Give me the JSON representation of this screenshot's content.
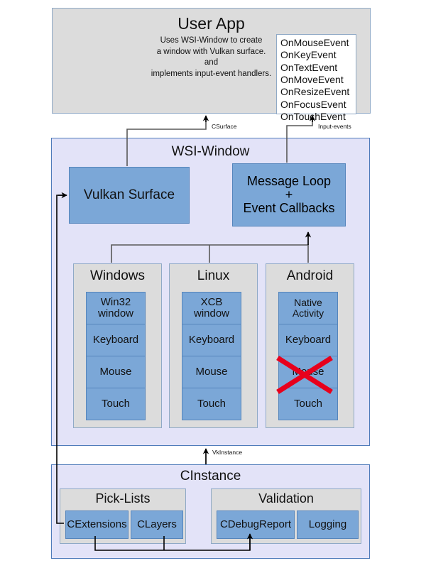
{
  "diagram": {
    "user_app": {
      "title": "User App",
      "description_lines": [
        "Uses WSI-Window to create",
        "a window with Vulkan surface.",
        "and",
        "implements input-event handlers."
      ],
      "events": [
        "OnMouseEvent",
        "OnKeyEvent",
        "OnTextEvent",
        "OnMoveEvent",
        "OnResizeEvent",
        "OnFocusEvent",
        "OnTouchEvent"
      ]
    },
    "wsi_window": {
      "title": "WSI-Window",
      "vulkan_surface": "Vulkan Surface",
      "message_loop_lines": [
        "Message Loop",
        "+",
        "Event Callbacks"
      ],
      "platforms": [
        {
          "name": "Windows",
          "items": [
            {
              "label": "Win32 window",
              "disabled": false
            },
            {
              "label": "Keyboard",
              "disabled": false
            },
            {
              "label": "Mouse",
              "disabled": false
            },
            {
              "label": "Touch",
              "disabled": false
            }
          ]
        },
        {
          "name": "Linux",
          "items": [
            {
              "label": "XCB window",
              "disabled": false
            },
            {
              "label": "Keyboard",
              "disabled": false
            },
            {
              "label": "Mouse",
              "disabled": false
            },
            {
              "label": "Touch",
              "disabled": false
            }
          ]
        },
        {
          "name": "Android",
          "items": [
            {
              "label": "Native Activity",
              "disabled": false
            },
            {
              "label": "Keyboard",
              "disabled": false
            },
            {
              "label": "Mouse",
              "disabled": true
            },
            {
              "label": "Touch",
              "disabled": false
            }
          ]
        }
      ]
    },
    "cinstance": {
      "title": "CInstance",
      "pick_lists": {
        "title": "Pick-Lists",
        "items": [
          "CExtensions",
          "CLayers"
        ]
      },
      "validation": {
        "title": "Validation",
        "items": [
          "CDebugReport",
          "Logging"
        ]
      }
    },
    "edge_labels": {
      "csurface": "CSurface",
      "input_events": "Input-events",
      "vkinstance": "VkInstance"
    },
    "colors": {
      "blue_node": "#7BA7D7",
      "blue_node_border": "#5585BC",
      "grey_box": "#DCDCDC",
      "grey_box_border": "#8FA9C6",
      "lavender_box": "#E3E3F8",
      "lavender_box_border": "#4F7BBA",
      "disabled_mark": "#E8001C",
      "wire": "#000000",
      "wire_grey": "#595959"
    }
  }
}
